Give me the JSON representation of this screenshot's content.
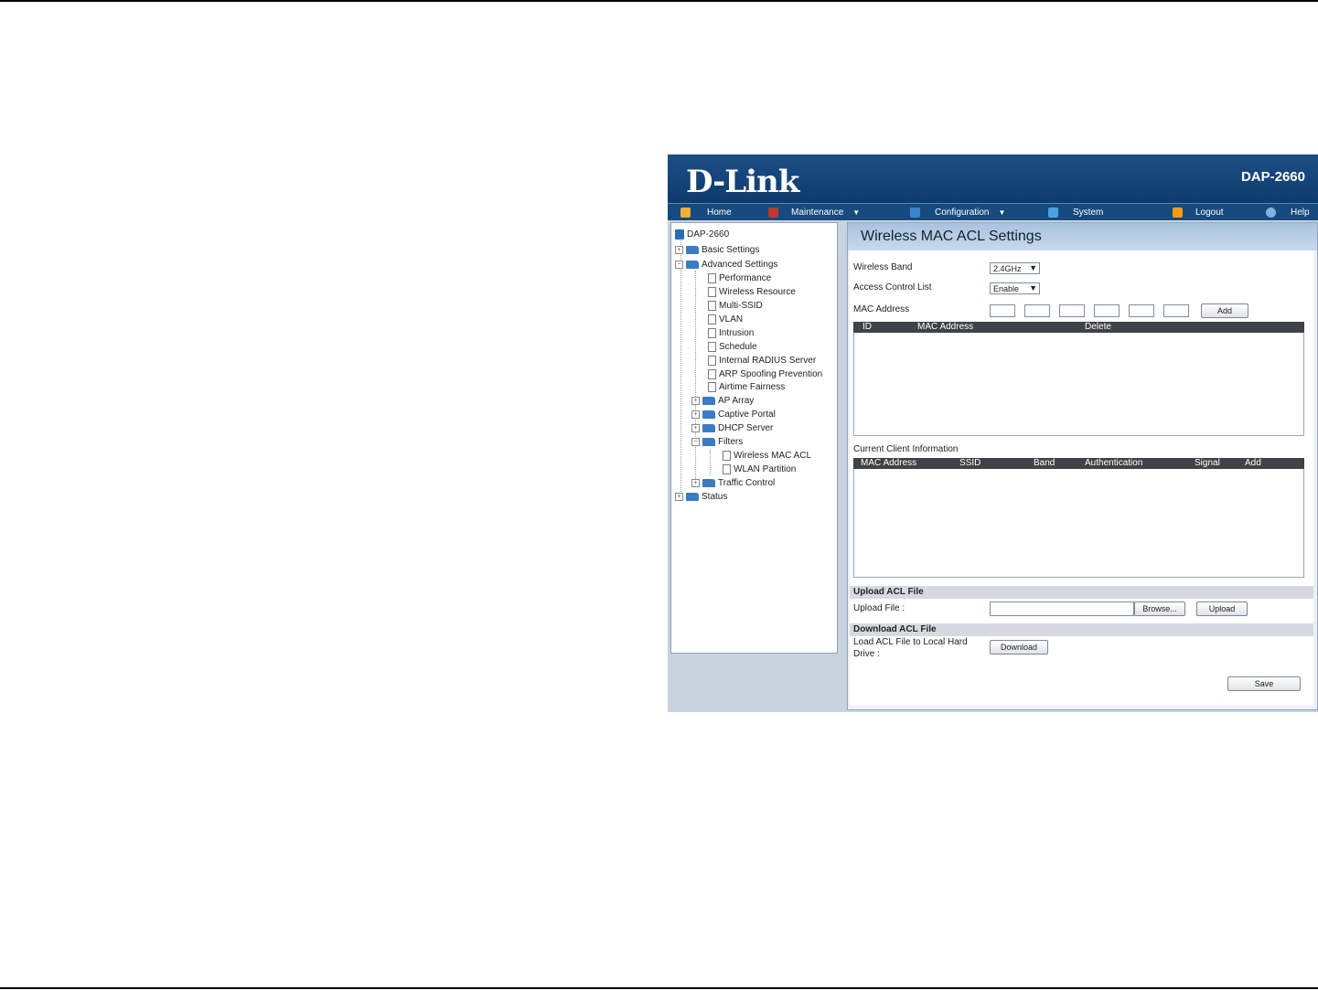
{
  "header": {
    "logo": "D-Link",
    "model": "DAP-2660"
  },
  "nav": {
    "items": [
      {
        "label": "Home",
        "icon": "home-icon"
      },
      {
        "label": "Maintenance",
        "icon": "tools-icon",
        "dropdown": true
      },
      {
        "label": "Configuration",
        "icon": "config-icon",
        "dropdown": true
      },
      {
        "label": "System",
        "icon": "system-icon"
      },
      {
        "label": "Logout",
        "icon": "logout-icon"
      },
      {
        "label": "Help",
        "icon": "help-icon"
      }
    ]
  },
  "tree": {
    "root": "DAP-2660",
    "basic_settings": "Basic Settings",
    "advanced_settings": "Advanced Settings",
    "performance": "Performance",
    "wireless_resource": "Wireless Resource",
    "multi_ssid": "Multi-SSID",
    "vlan": "VLAN",
    "intrusion": "Intrusion",
    "schedule": "Schedule",
    "internal_radius": "Internal RADIUS Server",
    "arp_spoofing": "ARP Spoofing Prevention",
    "airtime_fairness": "Airtime Fairness",
    "ap_array": "AP Array",
    "captive_portal": "Captive Portal",
    "dhcp_server": "DHCP Server",
    "filters": "Filters",
    "wireless_mac_acl": "Wireless MAC ACL",
    "wlan_partition": "WLAN Partition",
    "traffic_control": "Traffic Control",
    "status": "Status"
  },
  "page": {
    "title": "Wireless MAC ACL Settings",
    "wireless_band_label": "Wireless Band",
    "wireless_band_value": "2.4GHz",
    "acl_label": "Access Control List",
    "acl_value": "Enable",
    "mac_label": "MAC Address",
    "add_button": "Add",
    "acl_table": {
      "id": "ID",
      "mac": "MAC Address",
      "delete": "Delete"
    },
    "client_info_label": "Current Client Information",
    "client_table": {
      "mac": "MAC Address",
      "ssid": "SSID",
      "band": "Band",
      "auth": "Authentication",
      "signal": "Signal",
      "add": "Add"
    },
    "upload_section": "Upload ACL File",
    "upload_label": "Upload File :",
    "browse_button": "Browse...",
    "upload_button": "Upload",
    "download_section": "Download ACL File",
    "download_label_1": "Load ACL File to Local Hard",
    "download_label_2": "Drive :",
    "download_button": "Download",
    "save_button": "Save"
  },
  "colors": {
    "brand": "#0e3b6c",
    "nav": "#174a7e",
    "table_header": "#3f4246"
  }
}
